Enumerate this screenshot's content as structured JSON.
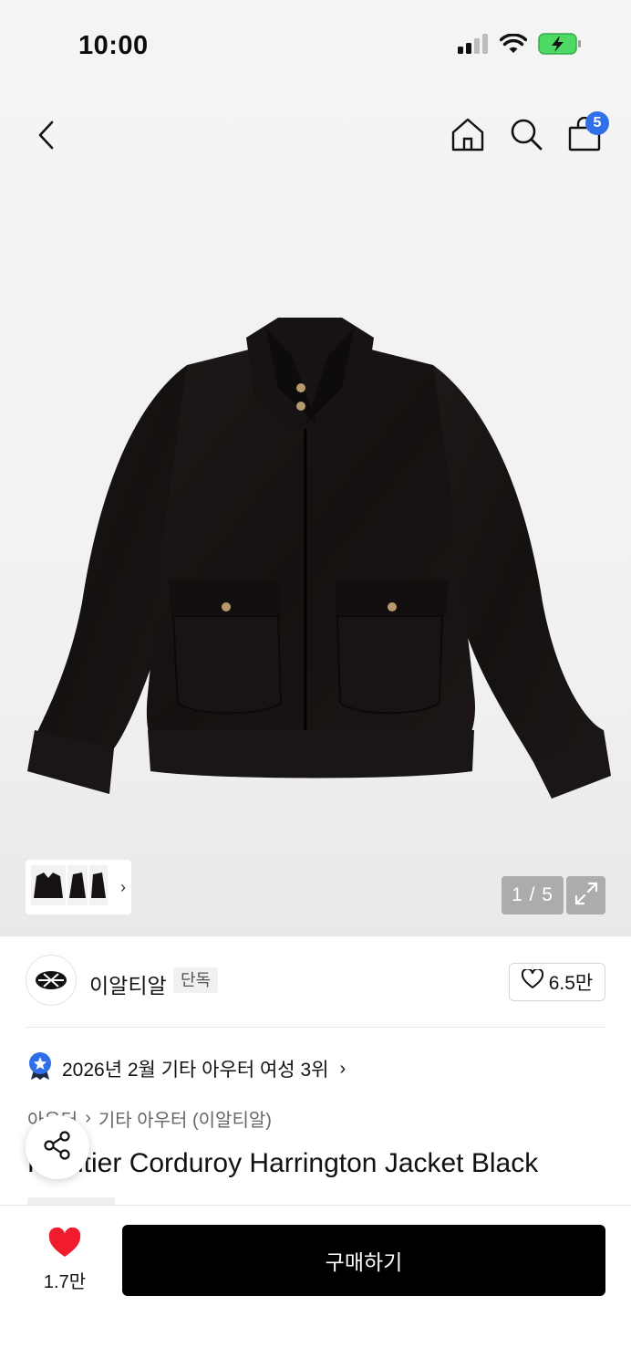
{
  "status_bar": {
    "time": "10:00"
  },
  "nav": {
    "cart_count": "5"
  },
  "gallery": {
    "counter": "1 / 5",
    "thumbnail_chevron": "›"
  },
  "brand": {
    "name": "이알티알",
    "tag": "단독",
    "likes": "6.5만"
  },
  "ranking": {
    "text": "2026년 2월 기타 아우터 여성 3위",
    "chevron": "›"
  },
  "breadcrumb": {
    "level1": "아우터",
    "separator": "›",
    "level2": "기타 아우터 (이알티알)"
  },
  "product": {
    "title": "Frontier Corduroy Harrington Jacket Black"
  },
  "bottom": {
    "wish_count": "1.7만",
    "buy_label": "구매하기"
  },
  "colors": {
    "accent_blue": "#2f6fe8",
    "heart_red": "#f01c2d",
    "buy_button": "#000000"
  },
  "icons": [
    "back-icon",
    "home-icon",
    "search-icon",
    "cart-icon",
    "expand-icon",
    "heart-outline-icon",
    "ranking-medal-icon",
    "share-icon",
    "heart-filled-icon",
    "signal-icon",
    "wifi-icon",
    "battery-icon"
  ]
}
